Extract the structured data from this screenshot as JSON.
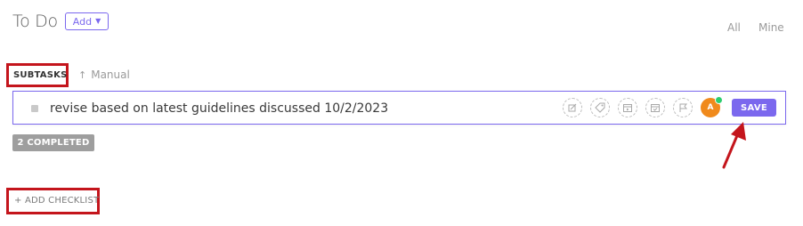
{
  "header": {
    "title": "To Do",
    "add_label": "Add",
    "filters": [
      "All",
      "Mine"
    ]
  },
  "subtasks": {
    "label": "SUBTASKS",
    "sort_label": "Manual"
  },
  "task": {
    "value": "revise based on latest guidelines discussed 10/2/2023",
    "action_icons": [
      "edit-icon",
      "tag-icon",
      "start-date-icon",
      "due-date-icon",
      "priority-flag-icon"
    ],
    "assignee_initial": "A",
    "save_label": "SAVE"
  },
  "completed": {
    "label": "2 COMPLETED"
  },
  "checklist": {
    "label": "+ ADD CHECKLIST"
  },
  "colors": {
    "accent": "#7b68ee",
    "annotation": "#c4151c",
    "avatar": "#f08a1c",
    "online": "#2ecd6f"
  }
}
